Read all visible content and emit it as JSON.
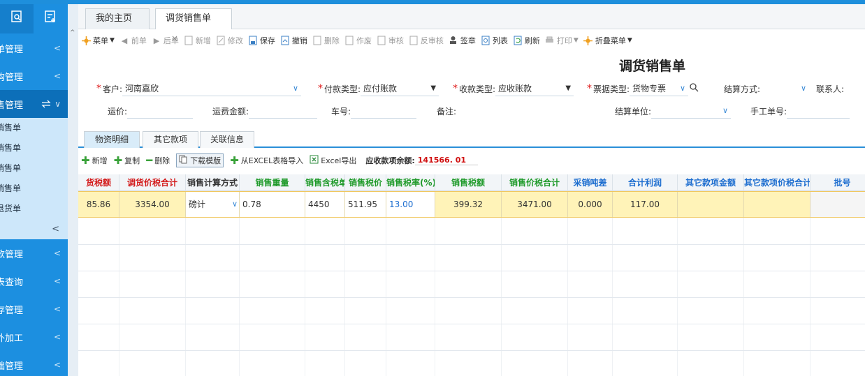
{
  "sidebar": {
    "items_top": [
      {
        "label": "单管理"
      },
      {
        "label": "购管理"
      }
    ],
    "active": {
      "label": "售管理"
    },
    "subitems": [
      {
        "label": "销售单"
      },
      {
        "label": "销售单"
      },
      {
        "label": "销售单"
      },
      {
        "label": "销售单"
      },
      {
        "label": "退货单"
      }
    ],
    "items_bottom": [
      {
        "label": "款管理"
      },
      {
        "label": "表查询"
      },
      {
        "label": "存管理"
      },
      {
        "label": "外加工"
      },
      {
        "label": "础管理"
      }
    ],
    "chevron": "<",
    "active_chevron": "∨",
    "collapse": "<"
  },
  "tabs": {
    "home": "我的主页",
    "current": "调货销售单",
    "close": "×"
  },
  "toolbar": {
    "menu": "菜单",
    "prev": "前单",
    "next": "后单",
    "add": "新增",
    "edit": "修改",
    "save": "保存",
    "revoke": "撤销",
    "delete": "删除",
    "void": "作废",
    "audit": "审核",
    "unaudit": "反审核",
    "sign": "签章",
    "list": "列表",
    "refresh": "刷新",
    "print": "打印",
    "fold": "折叠菜单"
  },
  "form": {
    "title": "调货销售单",
    "customer_label": "客户:",
    "customer_value": "河南嘉欣",
    "pay_type_label": "付款类型:",
    "pay_type_value": "应付账款",
    "receive_type_label": "收款类型:",
    "receive_type_value": "应收账款",
    "invoice_type_label": "票据类型:",
    "invoice_type_value": "货物专票",
    "settle_method_label": "结算方式:",
    "settle_method_value": "",
    "contact_label": "联系人:",
    "freight_label": "运价:",
    "freight_amount_label": "运费金额:",
    "car_no_label": "车号:",
    "remark_label": "备注:",
    "settle_unit_label": "结算单位:",
    "manual_no_label": "手工单号:"
  },
  "inner_tabs": [
    "物资明细",
    "其它款项",
    "关联信息"
  ],
  "detail_toolbar": {
    "add": "新增",
    "copy": "复制",
    "delete": "删除",
    "download": "下载模版",
    "import": "从EXCEL表格导入",
    "export": "Excel导出",
    "balance_label": "应收款项余额:",
    "balance_value": "141566. 01"
  },
  "grid": {
    "headers": [
      {
        "label": "货税额",
        "color": "red"
      },
      {
        "label": "调货价税合计",
        "color": "red"
      },
      {
        "label": "销售计算方式",
        "color": "black"
      },
      {
        "label": "销售重量",
        "color": "green"
      },
      {
        "label": "销售含税单",
        "color": "green"
      },
      {
        "label": "销售税价",
        "color": "green"
      },
      {
        "label": "销售税率(%)",
        "color": "green"
      },
      {
        "label": "销售税额",
        "color": "green"
      },
      {
        "label": "销售价税合计",
        "color": "green"
      },
      {
        "label": "采销吨差",
        "color": "blue"
      },
      {
        "label": "合计利润",
        "color": "blue"
      },
      {
        "label": "其它款项金额",
        "color": "blue"
      },
      {
        "label": "其它款项价税合计",
        "color": "blue"
      },
      {
        "label": "批号",
        "color": "blue"
      }
    ],
    "row": {
      "c0": "85.86",
      "c1": "3354.00",
      "c2": "磅计",
      "c3": "0.78",
      "c4": "4450",
      "c5": "511.95",
      "c6": "13.00",
      "c7": "399.32",
      "c8": "3471.00",
      "c9": "0.000",
      "c10": "117.00",
      "c11": "",
      "c12": "",
      "c13": ""
    }
  }
}
